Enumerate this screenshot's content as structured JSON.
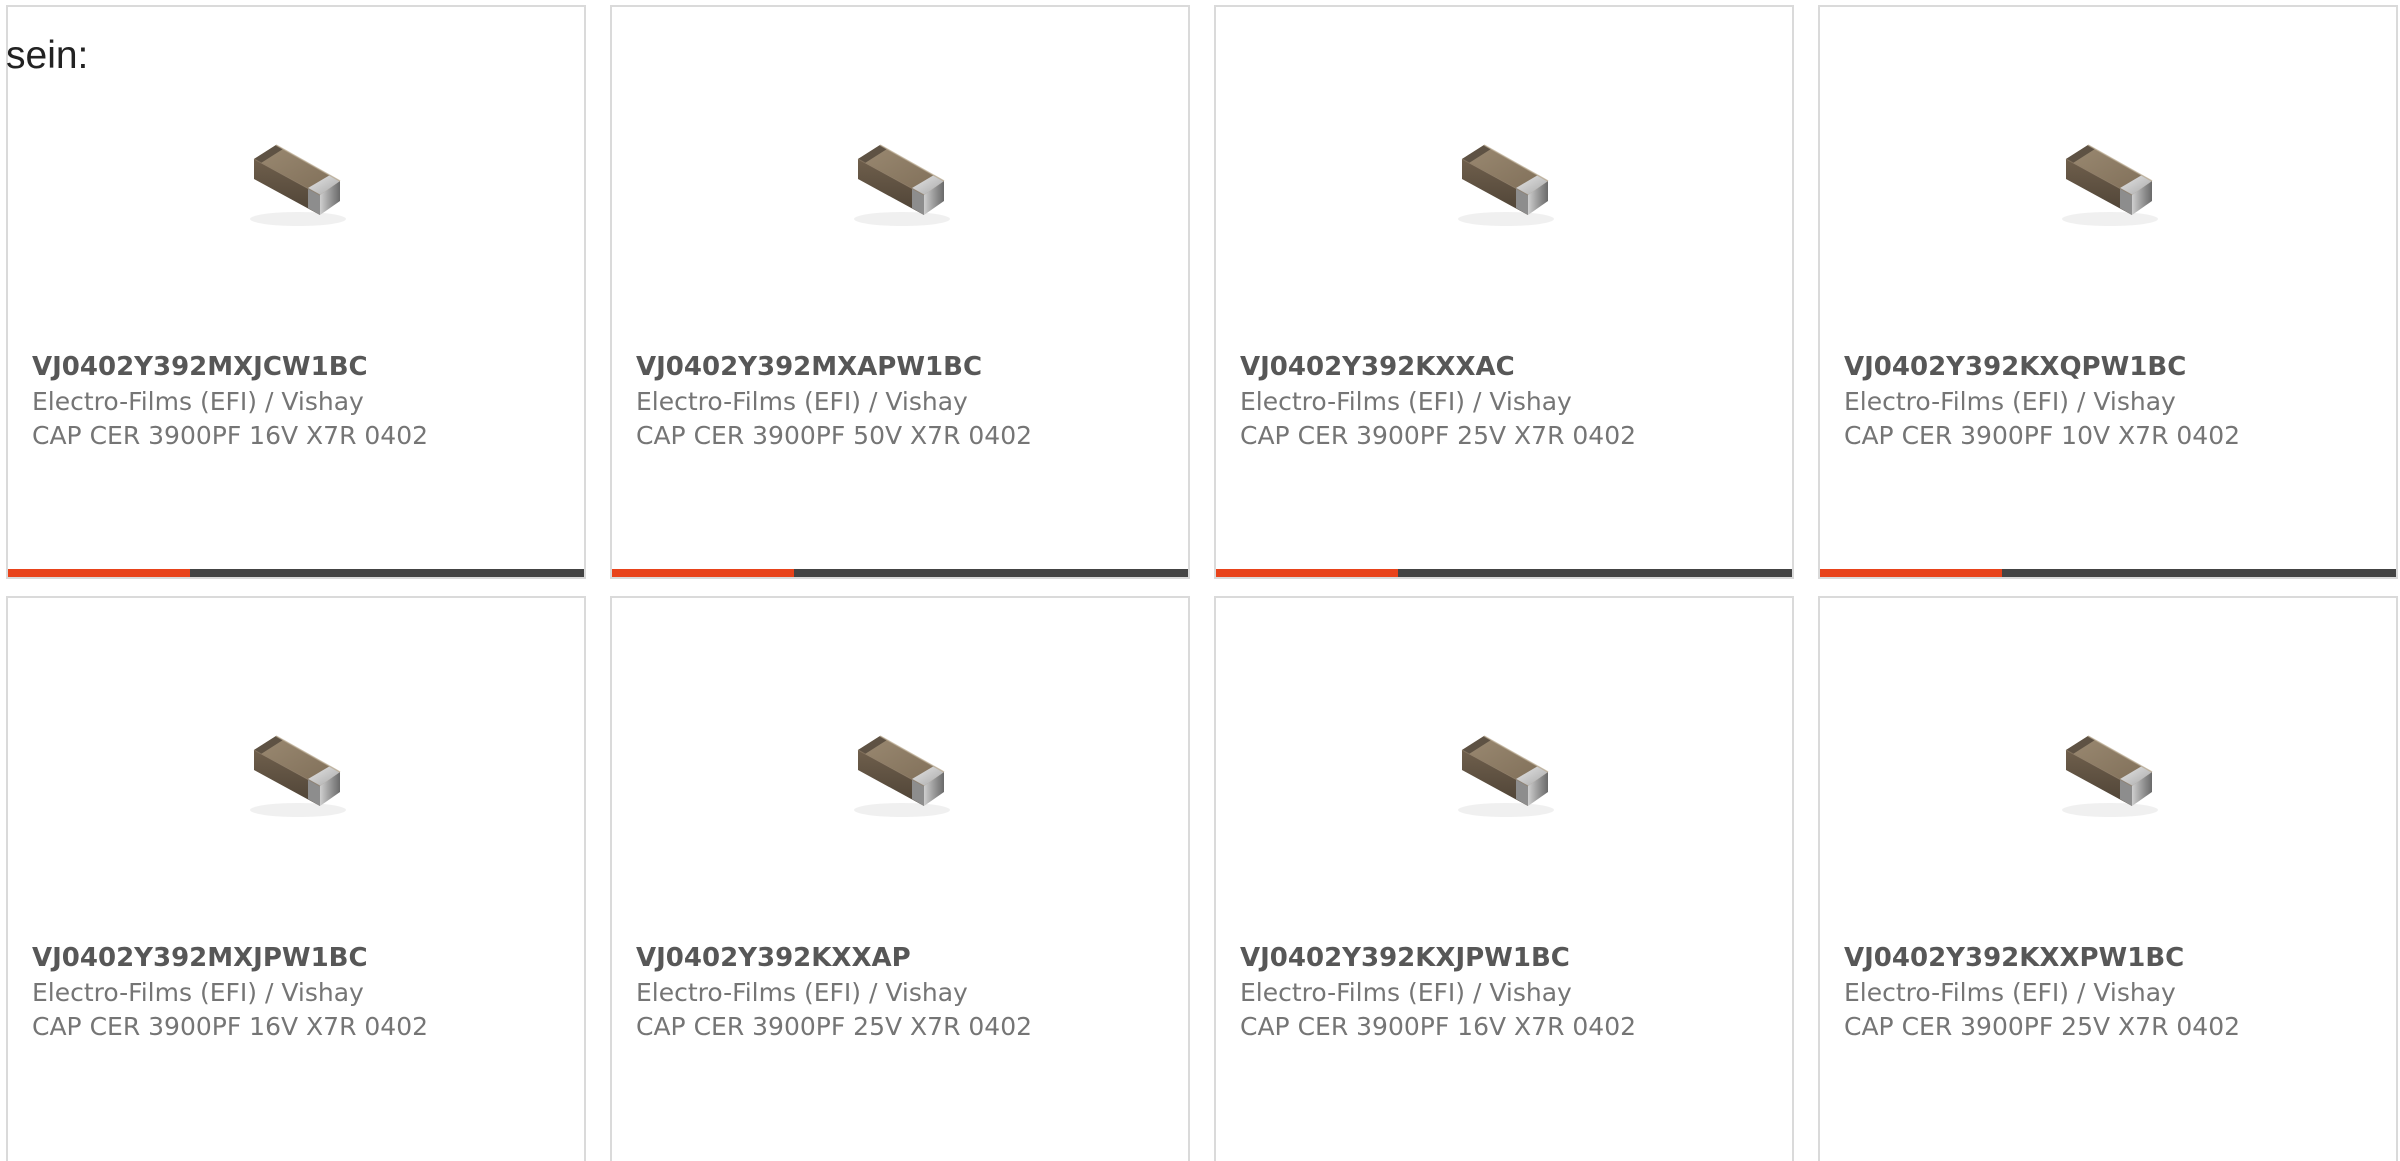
{
  "intro_text": "sein:",
  "accent_color": "#e8431b",
  "bar_color": "#444444",
  "cards": [
    {
      "part_number": "VJ0402Y392MXJCW1BC",
      "manufacturer": "Electro-Films (EFI) / Vishay",
      "description": "CAP CER 3900PF 16V X7R 0402",
      "image_icon": "ceramic-capacitor-icon"
    },
    {
      "part_number": "VJ0402Y392MXAPW1BC",
      "manufacturer": "Electro-Films (EFI) / Vishay",
      "description": "CAP CER 3900PF 50V X7R 0402",
      "image_icon": "ceramic-capacitor-icon"
    },
    {
      "part_number": "VJ0402Y392KXXAC",
      "manufacturer": "Electro-Films (EFI) / Vishay",
      "description": "CAP CER 3900PF 25V X7R 0402",
      "image_icon": "ceramic-capacitor-icon"
    },
    {
      "part_number": "VJ0402Y392KXQPW1BC",
      "manufacturer": "Electro-Films (EFI) / Vishay",
      "description": "CAP CER 3900PF 10V X7R 0402",
      "image_icon": "ceramic-capacitor-icon"
    },
    {
      "part_number": "VJ0402Y392MXJPW1BC",
      "manufacturer": "Electro-Films (EFI) / Vishay",
      "description": "CAP CER 3900PF 16V X7R 0402",
      "image_icon": "ceramic-capacitor-icon"
    },
    {
      "part_number": "VJ0402Y392KXXAP",
      "manufacturer": "Electro-Films (EFI) / Vishay",
      "description": "CAP CER 3900PF 25V X7R 0402",
      "image_icon": "ceramic-capacitor-icon"
    },
    {
      "part_number": "VJ0402Y392KXJPW1BC",
      "manufacturer": "Electro-Films (EFI) / Vishay",
      "description": "CAP CER 3900PF 16V X7R 0402",
      "image_icon": "ceramic-capacitor-icon"
    },
    {
      "part_number": "VJ0402Y392KXXPW1BC",
      "manufacturer": "Electro-Films (EFI) / Vishay",
      "description": "CAP CER 3900PF 25V X7R 0402",
      "image_icon": "ceramic-capacitor-icon"
    }
  ]
}
